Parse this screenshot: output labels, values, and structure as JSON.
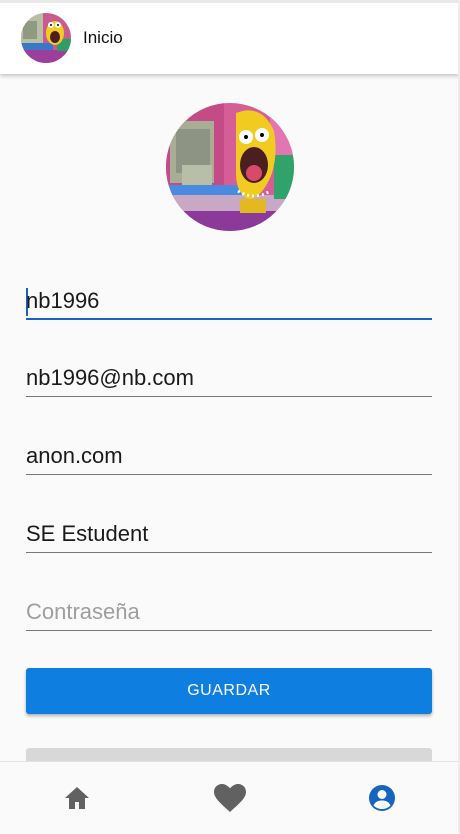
{
  "header": {
    "title": "Inicio"
  },
  "form": {
    "username": "nb1996",
    "email": "nb1996@nb.com",
    "website": "anon.com",
    "role": "SE Estudent",
    "password_placeholder": "Contraseña"
  },
  "buttons": {
    "save_label": "GUARDAR"
  },
  "bottom_nav": {
    "items": [
      {
        "icon": "home-icon",
        "color": "#616161"
      },
      {
        "icon": "heart-icon",
        "color": "#616161"
      },
      {
        "icon": "account-circle-icon",
        "color": "#1565c0"
      }
    ]
  },
  "colors": {
    "accent": "#0e7ee0",
    "active_nav": "#1565c0",
    "inactive_nav": "#616161"
  }
}
